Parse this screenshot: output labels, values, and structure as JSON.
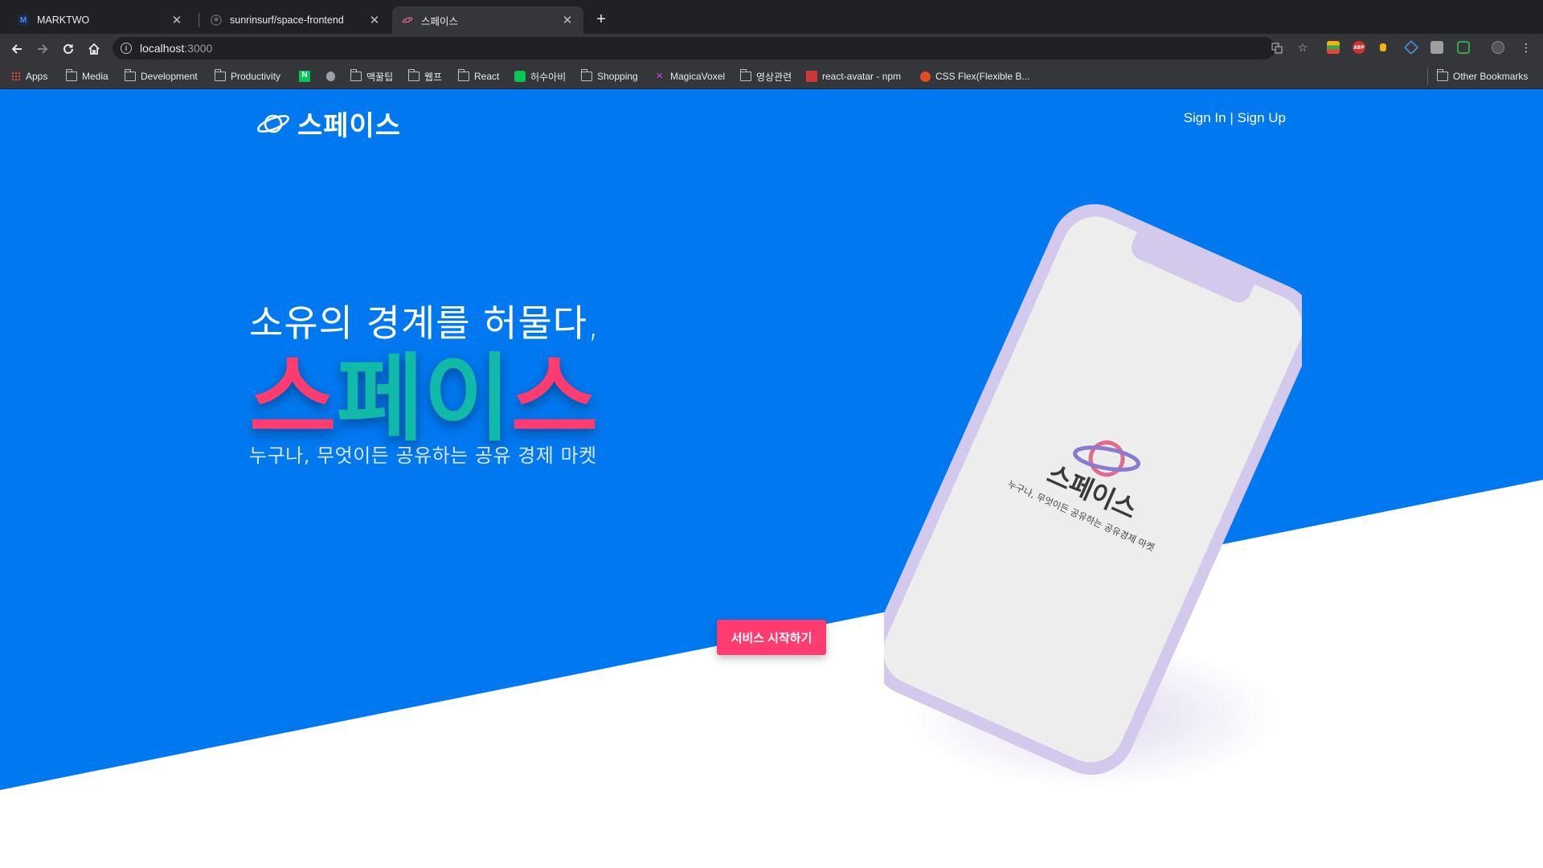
{
  "browser": {
    "tabs": [
      {
        "title": "MARKTWO",
        "icon": "M"
      },
      {
        "title": "sunrinsurf/space-frontend",
        "icon": "github"
      },
      {
        "title": "스페이스",
        "icon": "planet"
      }
    ],
    "url_host": "localhost",
    "url_port": ":3000",
    "bookmarks": [
      {
        "label": "Apps",
        "icon": "apps-grid-icon"
      },
      {
        "label": "Media",
        "icon": "folder-icon"
      },
      {
        "label": "Development",
        "icon": "folder-icon"
      },
      {
        "label": "Productivity",
        "icon": "folder-icon"
      },
      {
        "label": "",
        "icon": "naver-icon"
      },
      {
        "label": "",
        "icon": "apple-icon"
      },
      {
        "label": "맥꿀팁",
        "icon": "folder-icon"
      },
      {
        "label": "웹프",
        "icon": "folder-icon"
      },
      {
        "label": "React",
        "icon": "folder-icon"
      },
      {
        "label": "허수아비",
        "icon": "line-icon"
      },
      {
        "label": "Shopping",
        "icon": "folder-icon"
      },
      {
        "label": "MagicaVoxel",
        "icon": "magicavoxel-icon"
      },
      {
        "label": "영상관련",
        "icon": "folder-icon"
      },
      {
        "label": "react-avatar - npm",
        "icon": "npm-icon"
      },
      {
        "label": "CSS Flex(Flexible B...",
        "icon": "css-icon"
      }
    ],
    "other_bookmarks": "Other Bookmarks"
  },
  "header": {
    "logo_text": "스페이스",
    "sign_in": "Sign In",
    "separator": "|",
    "sign_up": "Sign Up"
  },
  "hero": {
    "tagline": "소유의 경계를 허물다,",
    "brand_chars": [
      "스",
      "페",
      "이",
      "스"
    ],
    "subline": "누구나, 무엇이든 공유하는 공유 경제 마켓",
    "cta": "서비스 시작하기"
  },
  "phone_screen": {
    "brand_text": "스페이스",
    "sub_text": "누구나, 무엇이든 공유하는 공유경제 마켓"
  },
  "colors": {
    "hero_blue": "#0078f0",
    "brand_pink": "#fe3c6f",
    "brand_teal": "#11b9a8",
    "brand_dark": "#3a3a3a",
    "phone_frame": "#d3c9ec"
  }
}
